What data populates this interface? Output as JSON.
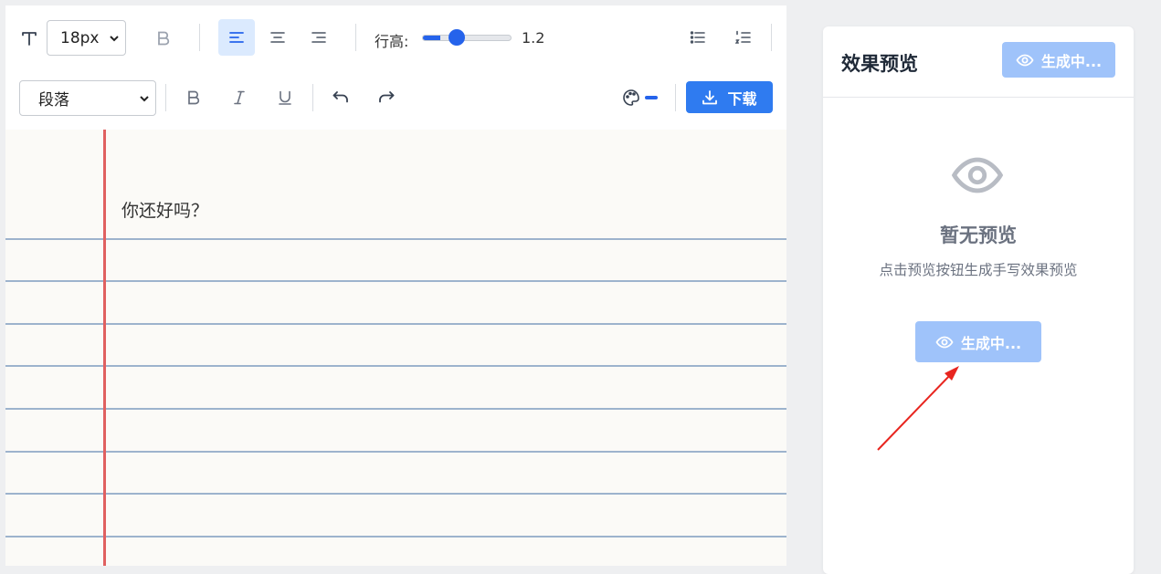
{
  "toolbar": {
    "font_size_value": "18px",
    "line_height_label": "行高:",
    "line_height_value": "1.2",
    "line_height_fraction": 0.2,
    "paragraph_value": "段落",
    "download_label": "下载",
    "accent_color": "#2f7bf0"
  },
  "paper": {
    "text": "你还好吗？"
  },
  "preview": {
    "title": "效果预览",
    "header_button_label": "生成中...",
    "empty_title": "暂无预览",
    "empty_description": "点击预览按钮生成手写效果预览",
    "center_button_label": "生成中..."
  },
  "icons": [
    "text-icon",
    "bold-icon",
    "align-left-icon",
    "align-center-icon",
    "align-right-icon",
    "bullet-list-icon",
    "numbered-list-icon",
    "italic-icon",
    "underline-icon",
    "undo-icon",
    "redo-icon",
    "palette-icon",
    "download-icon",
    "eye-icon"
  ]
}
